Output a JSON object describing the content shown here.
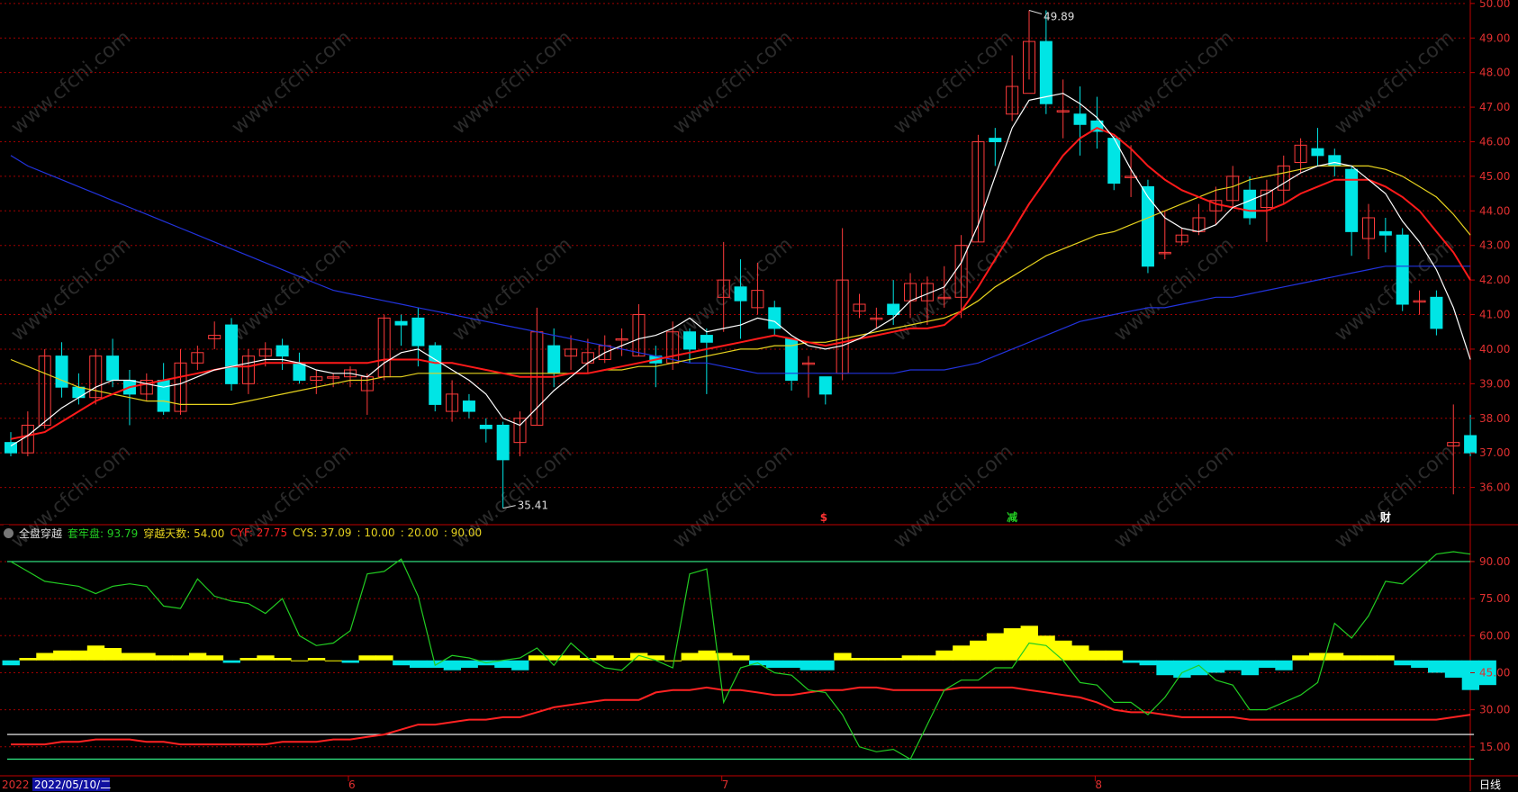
{
  "colors": {
    "up": "#ff3b3b",
    "down": "#00e5e5",
    "ma_short": "#ffffff",
    "ma_mid": "#ff1a1a",
    "ma_yellow": "#e6d21e",
    "ma_long": "#2233dd",
    "grid": "#a00000",
    "indicator_green": "#22cc22",
    "indicator_red": "#ff2222",
    "hist_pos": "#ffff00",
    "hist_neg": "#00e5e5",
    "ref_line_green": "#33ee88",
    "ref_line_white": "#ffffff"
  },
  "chart_data": [
    {
      "type": "candlestick",
      "y_axis_ticks": [
        "36.00",
        "37.00",
        "38.00",
        "39.00",
        "40.00",
        "41.00",
        "42.00",
        "43.00",
        "44.00",
        "45.00",
        "46.00",
        "47.00",
        "48.00",
        "49.00",
        "50.00"
      ],
      "ylim": [
        35.0,
        50.1
      ],
      "high_label": "49.89",
      "low_label": "35.41",
      "event_markers": [
        {
          "text": "$",
          "index": 48
        },
        {
          "text": "减",
          "index": 59
        },
        {
          "text": "财",
          "index": 81
        }
      ],
      "candles": [
        [
          37.3,
          37.0,
          37.6,
          36.9
        ],
        [
          37.0,
          37.8,
          38.2,
          36.9
        ],
        [
          37.8,
          39.8,
          40.0,
          37.7
        ],
        [
          39.8,
          38.9,
          40.2,
          38.6
        ],
        [
          38.9,
          38.6,
          39.3,
          38.4
        ],
        [
          38.6,
          39.8,
          40.0,
          38.4
        ],
        [
          39.8,
          39.1,
          40.3,
          38.9
        ],
        [
          39.1,
          38.7,
          39.4,
          37.8
        ],
        [
          38.7,
          39.1,
          39.3,
          38.5
        ],
        [
          39.1,
          38.2,
          39.6,
          38.1
        ],
        [
          38.2,
          39.6,
          40.0,
          38.1
        ],
        [
          39.6,
          39.9,
          40.1,
          39.4
        ],
        [
          40.3,
          40.4,
          40.8,
          40.0
        ],
        [
          40.7,
          39.0,
          40.9,
          38.8
        ],
        [
          39.0,
          39.8,
          40.0,
          38.7
        ],
        [
          39.8,
          40.0,
          40.2,
          39.5
        ],
        [
          40.1,
          39.8,
          40.3,
          39.4
        ],
        [
          39.6,
          39.1,
          39.9,
          39.0
        ],
        [
          39.1,
          39.2,
          39.4,
          38.7
        ],
        [
          39.2,
          39.2,
          39.3,
          38.9
        ],
        [
          39.2,
          39.4,
          39.5,
          38.9
        ],
        [
          38.8,
          39.2,
          39.3,
          38.1
        ],
        [
          39.2,
          40.9,
          41.0,
          39.1
        ],
        [
          40.8,
          40.7,
          41.0,
          40.1
        ],
        [
          40.9,
          40.1,
          41.2,
          39.5
        ],
        [
          40.1,
          38.4,
          40.2,
          38.2
        ],
        [
          38.2,
          38.7,
          39.1,
          37.9
        ],
        [
          38.5,
          38.2,
          38.7,
          38.0
        ],
        [
          37.8,
          37.7,
          38.0,
          37.3
        ],
        [
          37.8,
          36.8,
          37.9,
          35.4
        ],
        [
          37.3,
          38.0,
          38.2,
          36.9
        ],
        [
          37.8,
          40.5,
          41.2,
          37.8
        ],
        [
          40.1,
          39.3,
          40.6,
          38.9
        ],
        [
          39.8,
          40.0,
          40.4,
          39.4
        ],
        [
          39.6,
          39.9,
          40.3,
          39.3
        ],
        [
          39.7,
          40.1,
          40.4,
          39.6
        ],
        [
          40.3,
          40.3,
          40.6,
          39.8
        ],
        [
          39.8,
          41.0,
          41.3,
          39.8
        ],
        [
          39.8,
          39.6,
          40.1,
          38.9
        ],
        [
          39.6,
          40.5,
          40.8,
          39.4
        ],
        [
          40.5,
          40.0,
          40.6,
          39.6
        ],
        [
          40.4,
          40.2,
          40.6,
          38.7
        ],
        [
          41.5,
          42.0,
          43.1,
          40.5
        ],
        [
          41.8,
          41.4,
          42.6,
          40.3
        ],
        [
          41.2,
          41.7,
          42.5,
          41.0
        ],
        [
          41.2,
          40.6,
          41.4,
          40.4
        ],
        [
          40.3,
          39.1,
          40.3,
          38.8
        ],
        [
          39.6,
          39.6,
          39.8,
          38.6
        ],
        [
          39.2,
          38.7,
          39.2,
          38.4
        ],
        [
          39.3,
          42.0,
          43.5,
          39.1
        ],
        [
          41.1,
          41.3,
          41.6,
          40.9
        ],
        [
          40.9,
          40.9,
          41.2,
          40.6
        ],
        [
          41.3,
          41.0,
          42.0,
          40.7
        ],
        [
          41.4,
          41.9,
          42.2,
          40.9
        ],
        [
          41.4,
          41.9,
          42.1,
          40.7
        ],
        [
          41.5,
          41.5,
          42.4,
          41.2
        ],
        [
          41.5,
          43.0,
          43.3,
          40.9
        ],
        [
          43.1,
          46.0,
          46.2,
          43.1
        ],
        [
          46.1,
          46.0,
          46.4,
          45.3
        ],
        [
          46.8,
          47.6,
          48.5,
          46.6
        ],
        [
          47.4,
          48.9,
          49.8,
          47.8
        ],
        [
          48.9,
          47.1,
          49.8,
          46.8
        ],
        [
          46.9,
          46.9,
          47.8,
          46.1
        ],
        [
          46.8,
          46.5,
          47.6,
          45.6
        ],
        [
          46.6,
          46.3,
          47.3,
          45.8
        ],
        [
          46.1,
          44.8,
          46.2,
          44.6
        ],
        [
          45.0,
          45.0,
          45.9,
          44.4
        ],
        [
          44.7,
          42.4,
          44.9,
          42.2
        ],
        [
          42.8,
          42.8,
          44.0,
          42.6
        ],
        [
          43.1,
          43.3,
          43.5,
          43.0
        ],
        [
          43.4,
          43.8,
          44.2,
          43.3
        ],
        [
          44.0,
          44.3,
          44.7,
          43.6
        ],
        [
          44.3,
          45.0,
          45.3,
          44.1
        ],
        [
          44.6,
          43.8,
          45.0,
          43.6
        ],
        [
          44.1,
          44.6,
          44.9,
          43.1
        ],
        [
          44.6,
          45.3,
          45.6,
          44.2
        ],
        [
          45.4,
          45.9,
          46.1,
          45.1
        ],
        [
          45.8,
          45.6,
          46.4,
          45.3
        ],
        [
          45.6,
          45.3,
          45.8,
          45.0
        ],
        [
          45.2,
          43.4,
          45.3,
          42.7
        ],
        [
          43.2,
          43.8,
          44.2,
          42.6
        ],
        [
          43.4,
          43.3,
          43.8,
          42.8
        ],
        [
          43.3,
          41.3,
          43.5,
          41.1
        ],
        [
          41.4,
          41.4,
          41.7,
          41.0
        ],
        [
          41.5,
          40.6,
          41.7,
          40.4
        ],
        [
          37.2,
          37.3,
          38.4,
          35.8
        ],
        [
          37.5,
          37.0,
          38.1,
          36.9
        ]
      ],
      "ma_short": [
        37.2,
        37.5,
        37.9,
        38.3,
        38.6,
        38.9,
        39.1,
        39.1,
        39.0,
        38.9,
        39.0,
        39.2,
        39.4,
        39.5,
        39.6,
        39.7,
        39.7,
        39.6,
        39.4,
        39.3,
        39.3,
        39.2,
        39.6,
        39.9,
        40.0,
        39.7,
        39.4,
        39.1,
        38.7,
        38.0,
        37.8,
        38.3,
        38.8,
        39.2,
        39.6,
        39.9,
        40.1,
        40.3,
        40.4,
        40.6,
        40.9,
        40.5,
        40.6,
        40.7,
        40.9,
        40.8,
        40.4,
        40.1,
        40.0,
        40.1,
        40.3,
        40.6,
        40.9,
        41.4,
        41.6,
        41.8,
        42.5,
        43.6,
        45.0,
        46.4,
        47.2,
        47.3,
        47.4,
        47.1,
        46.7,
        46.1,
        45.2,
        44.4,
        43.8,
        43.5,
        43.4,
        43.6,
        44.1,
        44.3,
        44.5,
        44.8,
        45.1,
        45.3,
        45.4,
        45.3,
        44.9,
        44.5,
        43.7,
        43.1,
        42.3,
        41.2,
        39.7
      ],
      "ma_mid": [
        37.4,
        37.5,
        37.6,
        37.9,
        38.2,
        38.5,
        38.7,
        38.9,
        39.0,
        39.1,
        39.2,
        39.3,
        39.4,
        39.5,
        39.5,
        39.6,
        39.6,
        39.6,
        39.6,
        39.6,
        39.6,
        39.6,
        39.7,
        39.7,
        39.7,
        39.6,
        39.6,
        39.5,
        39.4,
        39.3,
        39.2,
        39.2,
        39.2,
        39.3,
        39.3,
        39.4,
        39.5,
        39.6,
        39.7,
        39.8,
        39.9,
        40.0,
        40.1,
        40.2,
        40.3,
        40.4,
        40.3,
        40.2,
        40.1,
        40.2,
        40.3,
        40.4,
        40.5,
        40.6,
        40.6,
        40.7,
        41.1,
        41.8,
        42.6,
        43.4,
        44.2,
        44.9,
        45.6,
        46.1,
        46.4,
        46.2,
        45.8,
        45.3,
        44.9,
        44.6,
        44.4,
        44.2,
        44.1,
        44.0,
        44.0,
        44.2,
        44.5,
        44.7,
        44.9,
        44.9,
        44.9,
        44.7,
        44.4,
        44.0,
        43.4,
        42.8,
        42.0
      ],
      "ma_yellow": [
        39.7,
        39.5,
        39.3,
        39.1,
        38.9,
        38.8,
        38.7,
        38.6,
        38.5,
        38.5,
        38.4,
        38.4,
        38.4,
        38.4,
        38.5,
        38.6,
        38.7,
        38.8,
        38.9,
        39.0,
        39.1,
        39.1,
        39.2,
        39.2,
        39.3,
        39.3,
        39.3,
        39.3,
        39.3,
        39.3,
        39.3,
        39.3,
        39.3,
        39.3,
        39.3,
        39.4,
        39.4,
        39.5,
        39.5,
        39.6,
        39.7,
        39.8,
        39.9,
        40.0,
        40.0,
        40.1,
        40.1,
        40.2,
        40.2,
        40.3,
        40.4,
        40.5,
        40.6,
        40.7,
        40.8,
        40.9,
        41.1,
        41.4,
        41.8,
        42.1,
        42.4,
        42.7,
        42.9,
        43.1,
        43.3,
        43.4,
        43.6,
        43.8,
        44.0,
        44.2,
        44.4,
        44.6,
        44.7,
        44.9,
        45.0,
        45.1,
        45.2,
        45.3,
        45.3,
        45.3,
        45.3,
        45.2,
        45.0,
        44.7,
        44.4,
        43.9,
        43.3
      ],
      "ma_long": [
        45.6,
        45.3,
        45.1,
        44.9,
        44.7,
        44.5,
        44.3,
        44.1,
        43.9,
        43.7,
        43.5,
        43.3,
        43.1,
        42.9,
        42.7,
        42.5,
        42.3,
        42.1,
        41.9,
        41.7,
        41.6,
        41.5,
        41.4,
        41.3,
        41.2,
        41.1,
        41.0,
        40.9,
        40.8,
        40.7,
        40.6,
        40.5,
        40.4,
        40.3,
        40.2,
        40.1,
        40.0,
        39.9,
        39.8,
        39.7,
        39.6,
        39.6,
        39.5,
        39.4,
        39.3,
        39.3,
        39.3,
        39.3,
        39.3,
        39.3,
        39.3,
        39.3,
        39.3,
        39.4,
        39.4,
        39.4,
        39.5,
        39.6,
        39.8,
        40.0,
        40.2,
        40.4,
        40.6,
        40.8,
        40.9,
        41.0,
        41.1,
        41.2,
        41.2,
        41.3,
        41.4,
        41.5,
        41.5,
        41.6,
        41.7,
        41.8,
        41.9,
        42.0,
        42.1,
        42.2,
        42.3,
        42.4,
        42.4,
        42.4,
        42.4,
        42.4,
        42.4
      ]
    },
    {
      "type": "line",
      "indicator_name": "全盘穿越",
      "legend": [
        {
          "label": "套牢盘: 93.79",
          "color": "#22cc22"
        },
        {
          "label": "穿越天数: 54.00",
          "color": "#e6d21e"
        },
        {
          "label": "CYF: 27.75",
          "color": "#ff2222"
        },
        {
          "label": "CYS: 37.09",
          "color": "#e6d21e"
        },
        {
          "label": ": 10.00",
          "color": "#e6d21e"
        },
        {
          "label": ": 20.00",
          "color": "#e6d21e"
        },
        {
          "label": ": 90.00",
          "color": "#e6d21e"
        }
      ],
      "y_axis_ticks": [
        "15.00",
        "30.00",
        "45.00",
        "60.00",
        "75.00",
        "90.00"
      ],
      "ylim": [
        4,
        98
      ],
      "ref_lines": [
        10,
        20,
        90
      ],
      "hist_baseline": 50,
      "tao_lao_pan": [
        90,
        86,
        82,
        81,
        80,
        77,
        80,
        81,
        80,
        72,
        71,
        83,
        76,
        74,
        73,
        69,
        75,
        60,
        56,
        57,
        62,
        85,
        86,
        91,
        76,
        48,
        52,
        51,
        49,
        50,
        51,
        55,
        48,
        57,
        51,
        47,
        46,
        52,
        50,
        47,
        85,
        87,
        33,
        47,
        49,
        45,
        44,
        38,
        37,
        28,
        15,
        13,
        14,
        10,
        24,
        38,
        42,
        42,
        47,
        47,
        57,
        56,
        50,
        41,
        40,
        33,
        33,
        28,
        35,
        45,
        48,
        42,
        40,
        30,
        30,
        33,
        36,
        41,
        65,
        59,
        68,
        82,
        81,
        87,
        93,
        94,
        93
      ],
      "cyf": [
        16,
        16,
        16,
        17,
        17,
        18,
        18,
        18,
        17,
        17,
        16,
        16,
        16,
        16,
        16,
        16,
        17,
        17,
        17,
        18,
        18,
        19,
        20,
        22,
        24,
        24,
        25,
        26,
        26,
        27,
        27,
        29,
        31,
        32,
        33,
        34,
        34,
        34,
        37,
        38,
        38,
        39,
        38,
        38,
        37,
        36,
        36,
        37,
        38,
        38,
        39,
        39,
        38,
        38,
        38,
        38,
        39,
        39,
        39,
        39,
        38,
        37,
        36,
        35,
        33,
        30,
        29,
        29,
        28,
        27,
        27,
        27,
        27,
        26,
        26,
        26,
        26,
        26,
        26,
        26,
        26,
        26,
        26,
        26,
        26,
        27,
        28
      ],
      "hist": [
        -2,
        1,
        3,
        4,
        4,
        6,
        5,
        3,
        3,
        2,
        2,
        3,
        2,
        -1,
        1,
        2,
        1,
        0,
        1,
        0,
        -1,
        2,
        2,
        -2,
        -3,
        -3,
        -4,
        -3,
        -2,
        -3,
        -4,
        2,
        2,
        2,
        1,
        2,
        1,
        3,
        2,
        0,
        3,
        4,
        3,
        2,
        -2,
        -3,
        -3,
        -4,
        -4,
        3,
        1,
        1,
        1,
        2,
        2,
        4,
        6,
        8,
        11,
        13,
        14,
        10,
        8,
        6,
        4,
        4,
        -1,
        -2,
        -6,
        -7,
        -6,
        -5,
        -4,
        -6,
        -3,
        -4,
        2,
        3,
        3,
        2,
        2,
        2,
        -2,
        -3,
        -5,
        -7,
        -12,
        -10
      ]
    }
  ],
  "bottom_axis": {
    "dates": [
      {
        "text": "2022",
        "pos_index": 0
      },
      {
        "text": "2022/05/10/二",
        "pos_index": 1
      },
      {
        "text": "6",
        "pos_index": 20
      },
      {
        "text": "7",
        "pos_index": 42
      },
      {
        "text": "8",
        "pos_index": 64
      }
    ],
    "period_label": "日线"
  },
  "watermark": "www.cfchi.com"
}
